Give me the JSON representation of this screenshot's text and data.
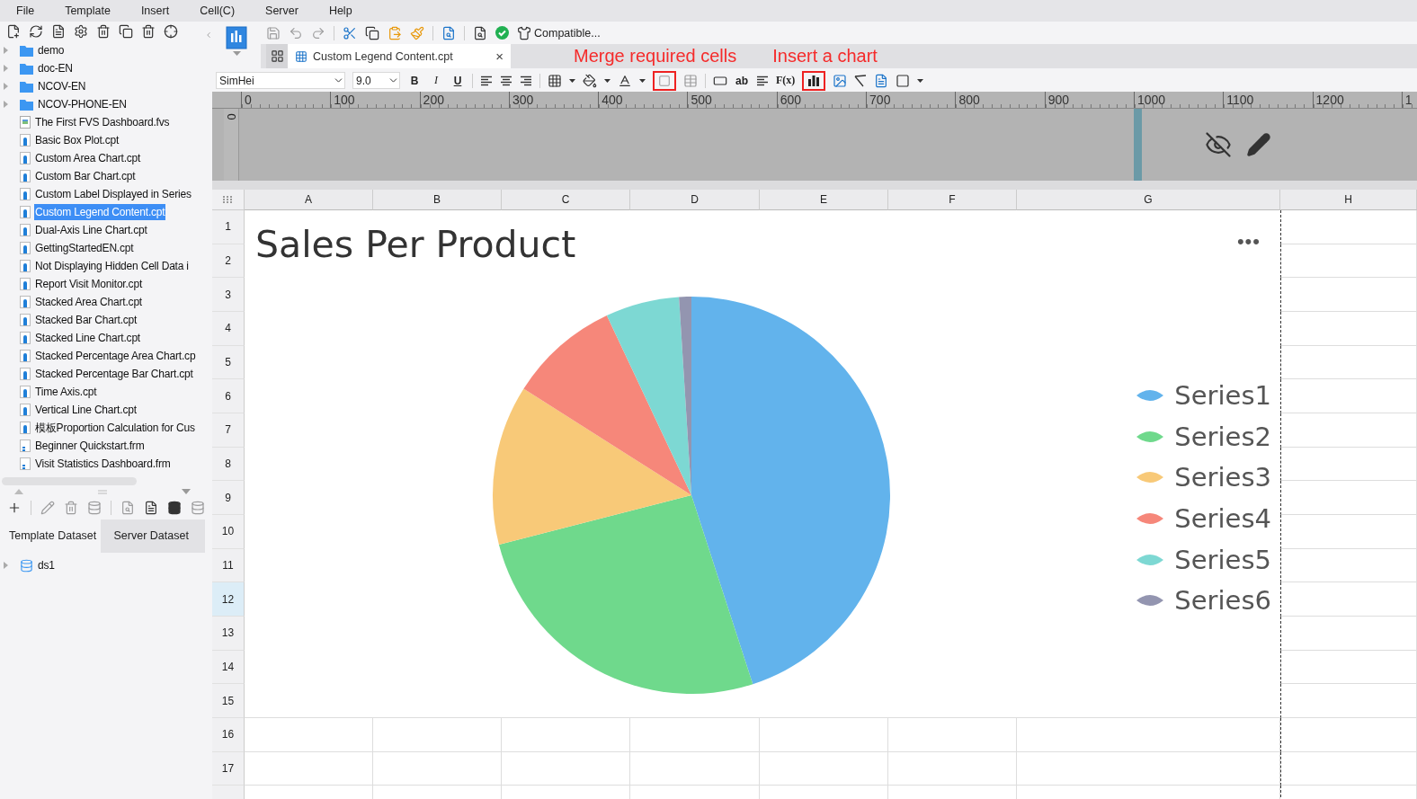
{
  "menu": [
    "File",
    "Template",
    "Insert",
    "Cell(C)",
    "Server",
    "Help"
  ],
  "sidebar": {
    "tree": [
      {
        "label": "demo",
        "kind": "folder",
        "expanded": false,
        "selected": false
      },
      {
        "label": "doc-EN",
        "kind": "folder",
        "expanded": false,
        "selected": false
      },
      {
        "label": "NCOV-EN",
        "kind": "folder",
        "expanded": false,
        "selected": false
      },
      {
        "label": "NCOV-PHONE-EN",
        "kind": "folder",
        "expanded": false,
        "selected": false
      },
      {
        "label": "The First FVS Dashboard.fvs",
        "kind": "fvs",
        "selected": false
      },
      {
        "label": "Basic Box Plot.cpt",
        "kind": "cpt",
        "selected": false
      },
      {
        "label": "Custom Area Chart.cpt",
        "kind": "cpt",
        "selected": false
      },
      {
        "label": "Custom Bar Chart.cpt",
        "kind": "cpt",
        "selected": false
      },
      {
        "label": "Custom Label Displayed in Series",
        "kind": "cpt",
        "selected": false
      },
      {
        "label": "Custom Legend Content.cpt",
        "kind": "cpt",
        "selected": true
      },
      {
        "label": "Dual-Axis Line Chart.cpt",
        "kind": "cpt",
        "selected": false
      },
      {
        "label": "GettingStartedEN.cpt",
        "kind": "cpt",
        "selected": false
      },
      {
        "label": "Not Displaying Hidden Cell Data i",
        "kind": "cpt",
        "selected": false
      },
      {
        "label": "Report Visit Monitor.cpt",
        "kind": "cpt",
        "selected": false
      },
      {
        "label": "Stacked Area Chart.cpt",
        "kind": "cpt",
        "selected": false
      },
      {
        "label": "Stacked Bar Chart.cpt",
        "kind": "cpt",
        "selected": false
      },
      {
        "label": "Stacked Line Chart.cpt",
        "kind": "cpt",
        "selected": false
      },
      {
        "label": "Stacked Percentage Area Chart.cp",
        "kind": "cpt",
        "selected": false
      },
      {
        "label": "Stacked Percentage Bar Chart.cpt",
        "kind": "cpt",
        "selected": false
      },
      {
        "label": "Time Axis.cpt",
        "kind": "cpt",
        "selected": false
      },
      {
        "label": "Vertical Line Chart.cpt",
        "kind": "cpt",
        "selected": false
      },
      {
        "label": "模板Proportion Calculation for Cus",
        "kind": "cpt",
        "selected": false
      },
      {
        "label": "Beginner Quickstart.frm",
        "kind": "frm",
        "selected": false
      },
      {
        "label": "Visit Statistics Dashboard.frm",
        "kind": "frm",
        "selected": false
      }
    ],
    "dataset_tabs": [
      {
        "label": "Template Dataset",
        "selected": true
      },
      {
        "label": "Server Dataset",
        "selected": false
      }
    ],
    "datasets": [
      {
        "label": "ds1",
        "expanded": false
      }
    ]
  },
  "toolbar": {
    "compatible": "Compatible..."
  },
  "document_tab": {
    "title": "Custom Legend Content.cpt",
    "close": "×"
  },
  "annotations": [
    "Merge required cells",
    "Insert a chart"
  ],
  "format_bar": {
    "font": "SimHei",
    "size": "9.0",
    "bold": "B",
    "italic": "I",
    "underline": "U",
    "text_label": "ab",
    "formula": "F(x)",
    "merge_cells_button": {
      "highlighted": true
    },
    "insert_chart_button": {
      "highlighted": true
    }
  },
  "ruler": {
    "labels": [
      "0",
      "100",
      "200",
      "300",
      "400",
      "500",
      "600",
      "700",
      "800",
      "900",
      "1000",
      "1100",
      "1200",
      "1"
    ],
    "vertical_label": "0"
  },
  "sheet": {
    "columns": [
      "A",
      "B",
      "C",
      "D",
      "E",
      "F",
      "G",
      "H"
    ],
    "rows": [
      {
        "label": "1",
        "selected": false
      },
      {
        "label": "2",
        "selected": false
      },
      {
        "label": "3",
        "selected": false
      },
      {
        "label": "4",
        "selected": false
      },
      {
        "label": "5",
        "selected": false
      },
      {
        "label": "6",
        "selected": false
      },
      {
        "label": "7",
        "selected": false
      },
      {
        "label": "8",
        "selected": false
      },
      {
        "label": "9",
        "selected": false
      },
      {
        "label": "10",
        "selected": false
      },
      {
        "label": "11",
        "selected": false
      },
      {
        "label": "12",
        "selected": true
      },
      {
        "label": "13",
        "selected": false
      },
      {
        "label": "14",
        "selected": false
      },
      {
        "label": "15",
        "selected": false
      },
      {
        "label": "16",
        "selected": false
      },
      {
        "label": "17",
        "selected": false
      }
    ]
  },
  "report": {
    "title": "Sales Per Product",
    "more": "•••",
    "legend": [
      {
        "name": "Series1",
        "color": "#62b3ec"
      },
      {
        "name": "Series2",
        "color": "#6fd98c"
      },
      {
        "name": "Series3",
        "color": "#f8c978"
      },
      {
        "name": "Series4",
        "color": "#f6877a"
      },
      {
        "name": "Series5",
        "color": "#7dd8d3"
      },
      {
        "name": "Series6",
        "color": "#9395b0"
      }
    ]
  }
}
